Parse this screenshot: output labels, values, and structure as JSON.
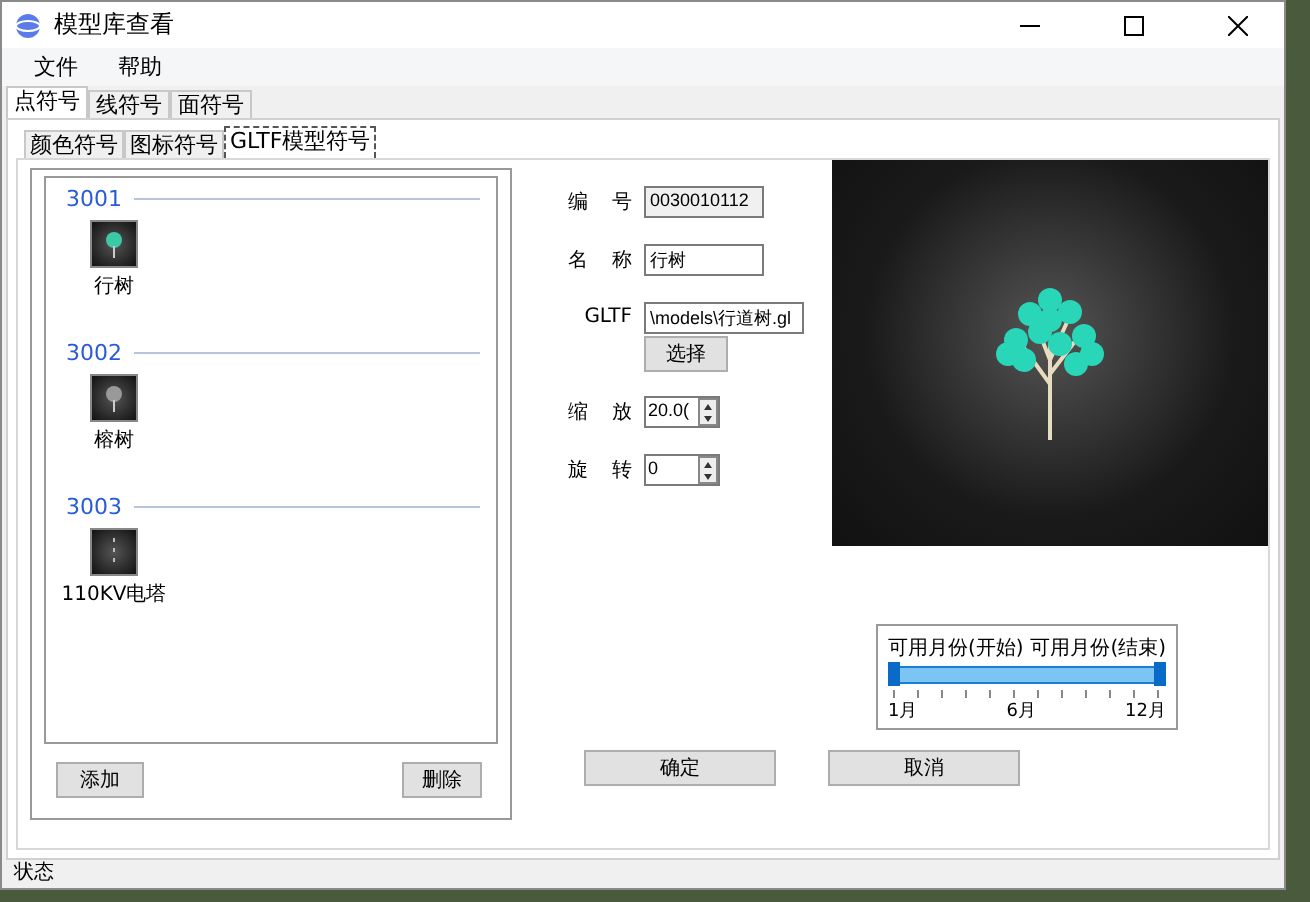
{
  "window": {
    "title": "模型库查看"
  },
  "menu": [
    "文件",
    "帮助"
  ],
  "tabs": [
    {
      "label": "点符号",
      "selected": true
    },
    {
      "label": "线符号",
      "selected": false
    },
    {
      "label": "面符号",
      "selected": false
    }
  ],
  "subtabs": [
    {
      "label": "颜色符号",
      "selected": false
    },
    {
      "label": "图标符号",
      "selected": false
    },
    {
      "label": "GLTF模型符号",
      "selected": true
    }
  ],
  "groups": [
    {
      "code": "3001",
      "items": [
        {
          "label": "行树",
          "kind": "tree"
        }
      ]
    },
    {
      "code": "3002",
      "items": [
        {
          "label": "榕树",
          "kind": "tree"
        }
      ]
    },
    {
      "code": "3003",
      "items": [
        {
          "label": "110KV电塔",
          "kind": "tower"
        }
      ]
    }
  ],
  "list_buttons": [
    "添加",
    "删除"
  ],
  "fields": [
    {
      "label": "编号",
      "value": "0030010112",
      "kind": "readonly"
    },
    {
      "label": "名称",
      "value": "行树",
      "kind": "text"
    },
    {
      "label": "GLTF",
      "value": "\\models\\行道树.gl",
      "kind": "text"
    }
  ],
  "choose_button": "选择",
  "spinners": [
    {
      "label": "缩放",
      "value": "20.0("
    },
    {
      "label": "旋转",
      "value": "0"
    }
  ],
  "month_range": {
    "start_label": "可用月份(开始)",
    "end_label": "可用月份(结束)",
    "thumbs": [
      {
        "level": 0
      },
      {
        "level": 1
      }
    ],
    "tick_labels": [
      "1月",
      "6月",
      "12月"
    ]
  },
  "dialog_buttons": [
    "确定",
    "取消"
  ],
  "status_bar": "状态"
}
